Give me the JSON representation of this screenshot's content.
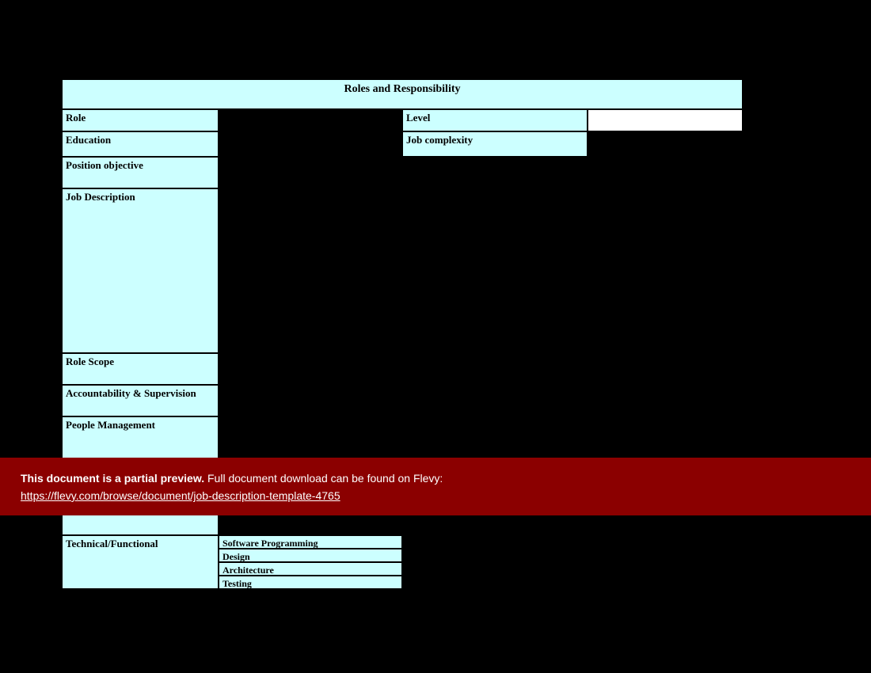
{
  "title": "Roles and Responsibility",
  "labels": {
    "role": "Role",
    "level": "Level",
    "education": "Education",
    "job_complexity": "Job complexity",
    "position_objective": "Position objective",
    "job_description": "Job Description",
    "role_scope": "Role Scope",
    "accountability": "Accountability & Supervision",
    "people_management": "People Management",
    "technical_functional": "Technical/Functional"
  },
  "tech_items": {
    "software_programming": "Software Programming",
    "design": "Design",
    "architecture": "Architecture",
    "testing": "Testing"
  },
  "banner": {
    "bold": "This document is a partial preview.",
    "rest": "  Full document download can be found on Flevy:",
    "url": "https://flevy.com/browse/document/job-description-template-4765"
  }
}
